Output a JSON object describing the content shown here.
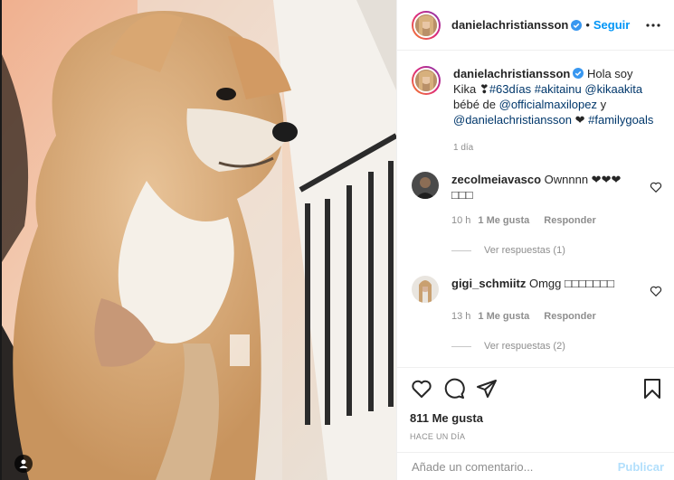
{
  "post": {
    "owner": "danielachristiansson",
    "follow_label": "Seguir",
    "separator": "•",
    "caption_text_1": "Hola soy Kika ",
    "caption_emoji": "❣",
    "caption_tag_1": "#63días",
    "caption_tag_2": "#akitainu",
    "caption_mention_1": "@kikaakita",
    "caption_text_2": "bébé de",
    "caption_mention_2": "@officialmaxilopez",
    "caption_text_3": "y",
    "caption_mention_3": "@danielachristiansson",
    "caption_heart": "❤",
    "caption_tag_3": "#familygoals",
    "caption_time": "1 día"
  },
  "comments": [
    {
      "user": "zecolmeiavasco",
      "text": "Ownnnn ❤❤❤□□□",
      "time": "10 h",
      "likes": "1 Me gusta",
      "reply": "Responder",
      "view_replies": "Ver respuestas (1)"
    },
    {
      "user": "gigi_schmiitz",
      "text": "Omgg □□□□□□□",
      "time": "13 h",
      "likes": "1 Me gusta",
      "reply": "Responder",
      "view_replies": "Ver respuestas (2)"
    }
  ],
  "actions": {
    "like_icon": "heart-icon",
    "comment_icon": "comment-icon",
    "share_icon": "share-icon",
    "save_icon": "bookmark-icon",
    "likes_count": "811 Me gusta",
    "posted_time": "HACE UN DÍA"
  },
  "add_comment": {
    "placeholder": "Añade un comentario...",
    "publish_label": "Publicar"
  },
  "colors": {
    "accent": "#0095f6",
    "link": "#00376b",
    "muted": "#8e8e8e",
    "publish_disabled": "#b2dffc"
  }
}
